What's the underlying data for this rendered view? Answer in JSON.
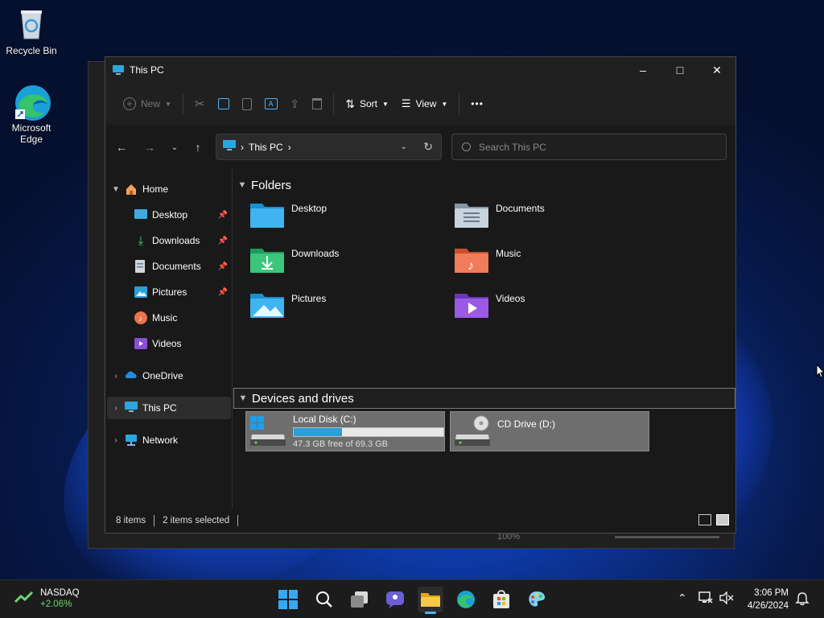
{
  "desktop": {
    "icons": [
      {
        "label": "Recycle Bin",
        "icon": "recycle-bin-icon"
      },
      {
        "label": "Microsoft Edge",
        "icon": "edge-icon"
      }
    ]
  },
  "background_window": {
    "status_zoom": "100%"
  },
  "window": {
    "title": "This PC",
    "controls": {
      "minimize": "–",
      "maximize": "□",
      "close": "✕"
    },
    "toolbar": {
      "new_label": "New",
      "sort_label": "Sort",
      "view_label": "View",
      "more_label": "•••"
    },
    "address": {
      "location": "This PC",
      "separator": "›"
    },
    "search": {
      "placeholder": "Search This PC"
    },
    "sidebar": {
      "home": "Home",
      "quick_access": [
        {
          "label": "Desktop",
          "pinned": true
        },
        {
          "label": "Downloads",
          "pinned": true
        },
        {
          "label": "Documents",
          "pinned": true
        },
        {
          "label": "Pictures",
          "pinned": true
        },
        {
          "label": "Music",
          "pinned": false
        },
        {
          "label": "Videos",
          "pinned": false
        }
      ],
      "onedrive": "OneDrive",
      "this_pc": "This PC",
      "network": "Network"
    },
    "content": {
      "folders_heading": "Folders",
      "folders": [
        "Desktop",
        "Documents",
        "Downloads",
        "Music",
        "Pictures",
        "Videos"
      ],
      "devices_heading": "Devices and drives",
      "drives": [
        {
          "name": "Local Disk (C:)",
          "free_text": "47.3 GB free of 69.3 GB",
          "used_fraction": 0.32
        },
        {
          "name": "CD Drive (D:)"
        }
      ]
    },
    "status": {
      "items": "8 items",
      "selected": "2 items selected"
    }
  },
  "taskbar": {
    "widget": {
      "name": "NASDAQ",
      "change": "+2.06%"
    },
    "clock": {
      "time": "3:06 PM",
      "date": "4/26/2024"
    }
  },
  "colors": {
    "accent": "#2b9fd9",
    "positive": "#6fd36f"
  }
}
